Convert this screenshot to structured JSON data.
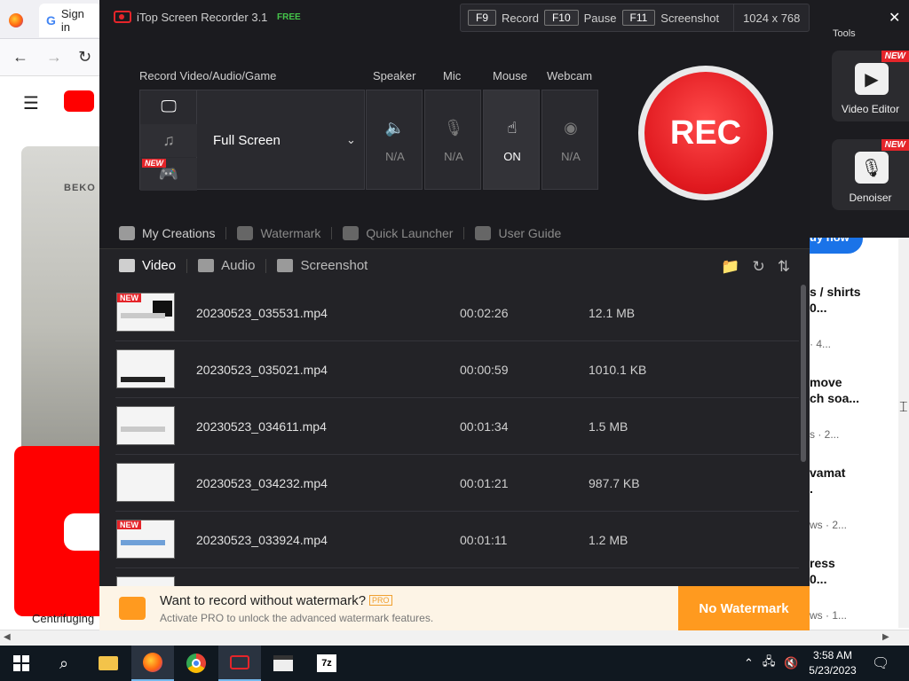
{
  "browser": {
    "tab_signin": "Sign in",
    "bg_caption": "Centrifuging",
    "brand_label": "BEKO",
    "side_items": [
      {
        "title_line1": "s / shirts",
        "title_line2": "0...",
        "meta": "· 4..."
      },
      {
        "title_line1": "move",
        "title_line2": "ch soa...",
        "meta": "s · 2..."
      },
      {
        "title_line1": "vamat",
        "title_line2": ".",
        "meta": "ws · 2..."
      },
      {
        "title_line1": "ress",
        "title_line2": "0...",
        "meta": "ws · 1..."
      }
    ],
    "buy_now": "uy now"
  },
  "tools": {
    "label": "Tools",
    "items": [
      {
        "name": "Video Editor",
        "badge": "NEW",
        "icon": "film-icon"
      },
      {
        "name": "Denoiser",
        "badge": "NEW",
        "icon": "mic-icon"
      }
    ]
  },
  "app": {
    "title": "iTop Screen Recorder 3.1",
    "edition": "FREE",
    "hotkeys": [
      {
        "key": "F9",
        "label": "Record"
      },
      {
        "key": "F10",
        "label": "Pause"
      },
      {
        "key": "F11",
        "label": "Screenshot"
      }
    ],
    "resolution": "1024 x 768",
    "record_section_label": "Record Video/Audio/Game",
    "mode_new_badge": "NEW",
    "mode_value": "Full Screen",
    "devices": [
      {
        "label": "Speaker",
        "value": "N/A",
        "icon": "speaker-icon",
        "active": false
      },
      {
        "label": "Mic",
        "value": "N/A",
        "icon": "mic-icon",
        "active": false
      },
      {
        "label": "Mouse",
        "value": "ON",
        "icon": "mouse-click-icon",
        "active": true
      },
      {
        "label": "Webcam",
        "value": "N/A",
        "icon": "webcam-icon",
        "active": false
      }
    ],
    "rec_label": "REC",
    "links": [
      "My Creations",
      "Watermark",
      "Quick Launcher",
      "User Guide"
    ],
    "library_tabs": [
      "Video",
      "Audio",
      "Screenshot"
    ],
    "files": [
      {
        "name": "20230523_035531.mp4",
        "duration": "00:02:26",
        "size": "12.1 MB",
        "new": true
      },
      {
        "name": "20230523_035021.mp4",
        "duration": "00:00:59",
        "size": "1010.1 KB",
        "new": false
      },
      {
        "name": "20230523_034611.mp4",
        "duration": "00:01:34",
        "size": "1.5 MB",
        "new": false
      },
      {
        "name": "20230523_034232.mp4",
        "duration": "00:01:21",
        "size": "987.7 KB",
        "new": false
      },
      {
        "name": "20230523_033924.mp4",
        "duration": "00:01:11",
        "size": "1.2 MB",
        "new": true
      }
    ],
    "new_badge": "NEW",
    "promo": {
      "title": "Want to record without watermark?",
      "pro_badge": "PRO",
      "subtitle": "Activate PRO to unlock the advanced watermark features.",
      "button": "No Watermark"
    }
  },
  "taskbar": {
    "time": "3:58 AM",
    "date": "5/23/2023",
    "app_7z": "7z"
  },
  "colors": {
    "accent_red": "#e5252a",
    "promo_orange": "#ff9a1f",
    "free_green": "#45c44a"
  }
}
